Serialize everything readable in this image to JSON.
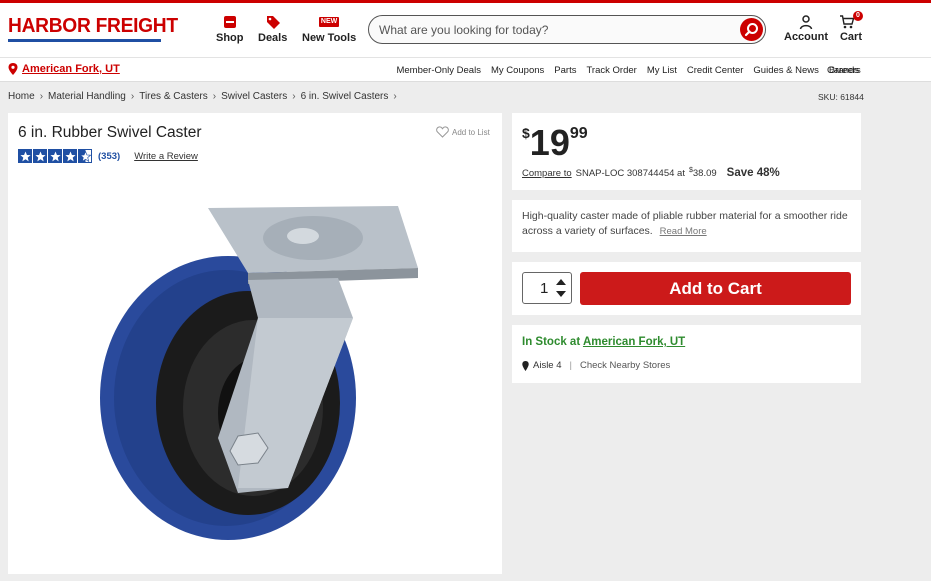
{
  "header": {
    "logo": "HARBOR FREIGHT",
    "nav": [
      {
        "label": "Shop",
        "icon": "shop-icon"
      },
      {
        "label": "Deals",
        "icon": "tag-icon"
      },
      {
        "label": "New Tools",
        "badge": "NEW",
        "icon": "new-badge-icon"
      }
    ],
    "search_placeholder": "What are you looking for today?",
    "account_label": "Account",
    "cart_label": "Cart",
    "cart_count": "0"
  },
  "subnav": {
    "store": "American Fork, UT",
    "links": [
      "Member-Only Deals",
      "My Coupons",
      "Parts",
      "Track Order",
      "My List",
      "Credit Center",
      "Guides & News",
      "Brands"
    ],
    "careers": "Careers"
  },
  "breadcrumb": [
    "Home",
    "Material Handling",
    "Tires & Casters",
    "Swivel Casters",
    "6 in. Swivel Casters"
  ],
  "sku": "SKU: 61844",
  "product": {
    "title": "6 in. Rubber Swivel Caster",
    "add_to_list": "Add to List",
    "rating": 4.5,
    "rating_count": "(353)",
    "write_review": "Write a Review"
  },
  "pricing": {
    "currency": "$",
    "whole": "19",
    "cents": "99",
    "compare_label": "Compare to",
    "compare_text": "SNAP-LOC 308744454 at",
    "compare_currency": "$",
    "compare_price": "38.09",
    "save": "Save 48%"
  },
  "description": {
    "text": "High-quality caster made of pliable rubber material for a smoother ride across a variety of surfaces.",
    "read_more": "Read More"
  },
  "purchase": {
    "quantity": "1",
    "add_to_cart": "Add to Cart"
  },
  "stock": {
    "status": "In Stock at",
    "store": "American Fork, UT",
    "aisle": "Aisle 4",
    "nearby": "Check Nearby Stores"
  },
  "colors": {
    "brand_red": "#cc0000",
    "brand_blue": "#1f4fa3",
    "stock_green": "#2e8b2e"
  }
}
